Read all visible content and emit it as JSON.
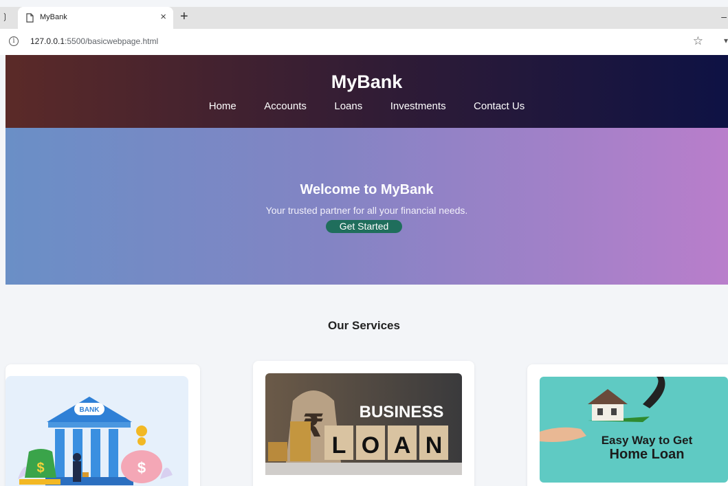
{
  "browser": {
    "tab_title": "MyBank",
    "new_tab_glyph": "+",
    "close_glyph": "×",
    "url_host": "127.0.0.1",
    "url_path": ":5500/basicwebpage.html"
  },
  "header": {
    "brand": "MyBank",
    "nav": [
      "Home",
      "Accounts",
      "Loans",
      "Investments",
      "Contact Us"
    ]
  },
  "hero": {
    "title": "Welcome to MyBank",
    "subtitle": "Your trusted partner for all your financial needs.",
    "cta_label": "Get Started"
  },
  "services": {
    "title": "Our Services",
    "cards": [
      {
        "image_text": "BANK",
        "icon": "bank-building-icon"
      },
      {
        "image_text_top": "BUSINESS",
        "image_text_letters": [
          "L",
          "O",
          "A",
          "N"
        ],
        "icon": "business-loan-image"
      },
      {
        "image_text_line1": "Easy Way to Get",
        "image_text_line2": "Home Loan",
        "icon": "home-loan-image"
      }
    ]
  },
  "colors": {
    "header_start": "#5b2a28",
    "header_end": "#0e1244",
    "hero_start": "#6a8fc6",
    "hero_end": "#b97ecb",
    "cta_bg": "#1f6e5c"
  }
}
